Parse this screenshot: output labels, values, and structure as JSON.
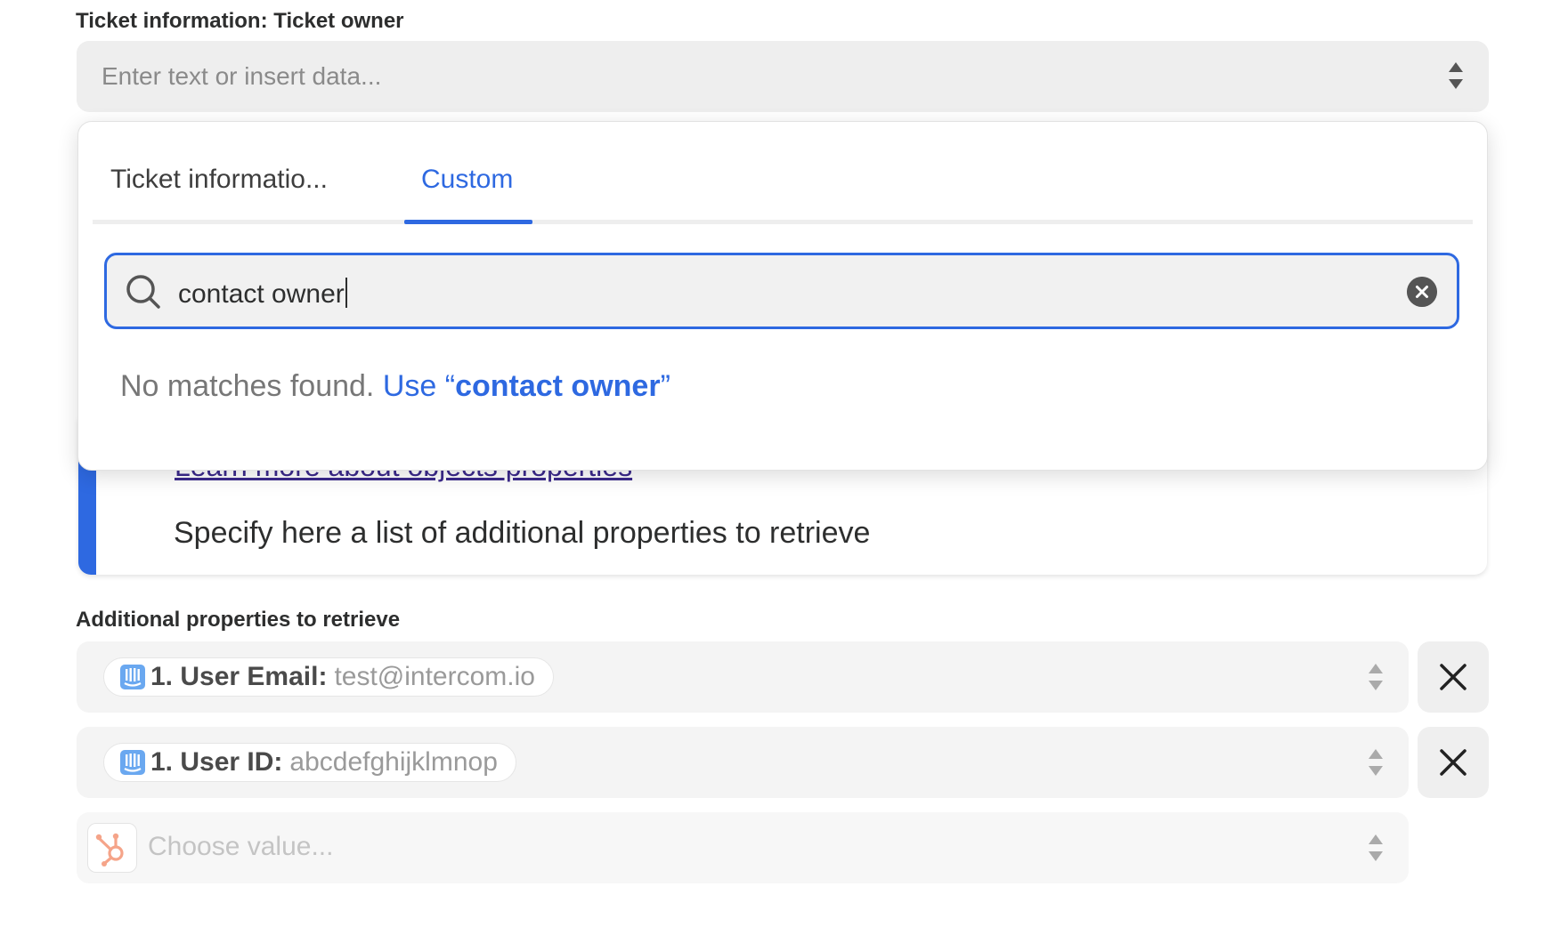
{
  "ticket_owner": {
    "label": "Ticket information: Ticket owner",
    "placeholder": "Enter text or insert data..."
  },
  "dropdown": {
    "tabs": [
      {
        "label": "Ticket informatio...",
        "active": false
      },
      {
        "label": "Custom",
        "active": true
      }
    ],
    "search": {
      "value": "contact owner"
    },
    "no_matches": "No matches found.",
    "use_prefix": "Use “",
    "use_value": "contact owner",
    "use_suffix": "”"
  },
  "help": {
    "link": "Learn more about objects properties",
    "text": "Specify here a list of additional properties to retrieve"
  },
  "additional_properties": {
    "label": "Additional properties to retrieve",
    "rows": [
      {
        "app_icon": "intercom-icon",
        "label": "1. User Email:",
        "value": "test@intercom.io"
      },
      {
        "app_icon": "intercom-icon",
        "label": "1. User ID:",
        "value": "abcdefghijklmnop"
      }
    ],
    "new_row": {
      "app_icon": "hubspot-icon",
      "placeholder": "Choose value..."
    }
  },
  "colors": {
    "accent": "#2e69e1",
    "hubspot": "#ff7a59",
    "intercom": "#6aa8f0"
  }
}
